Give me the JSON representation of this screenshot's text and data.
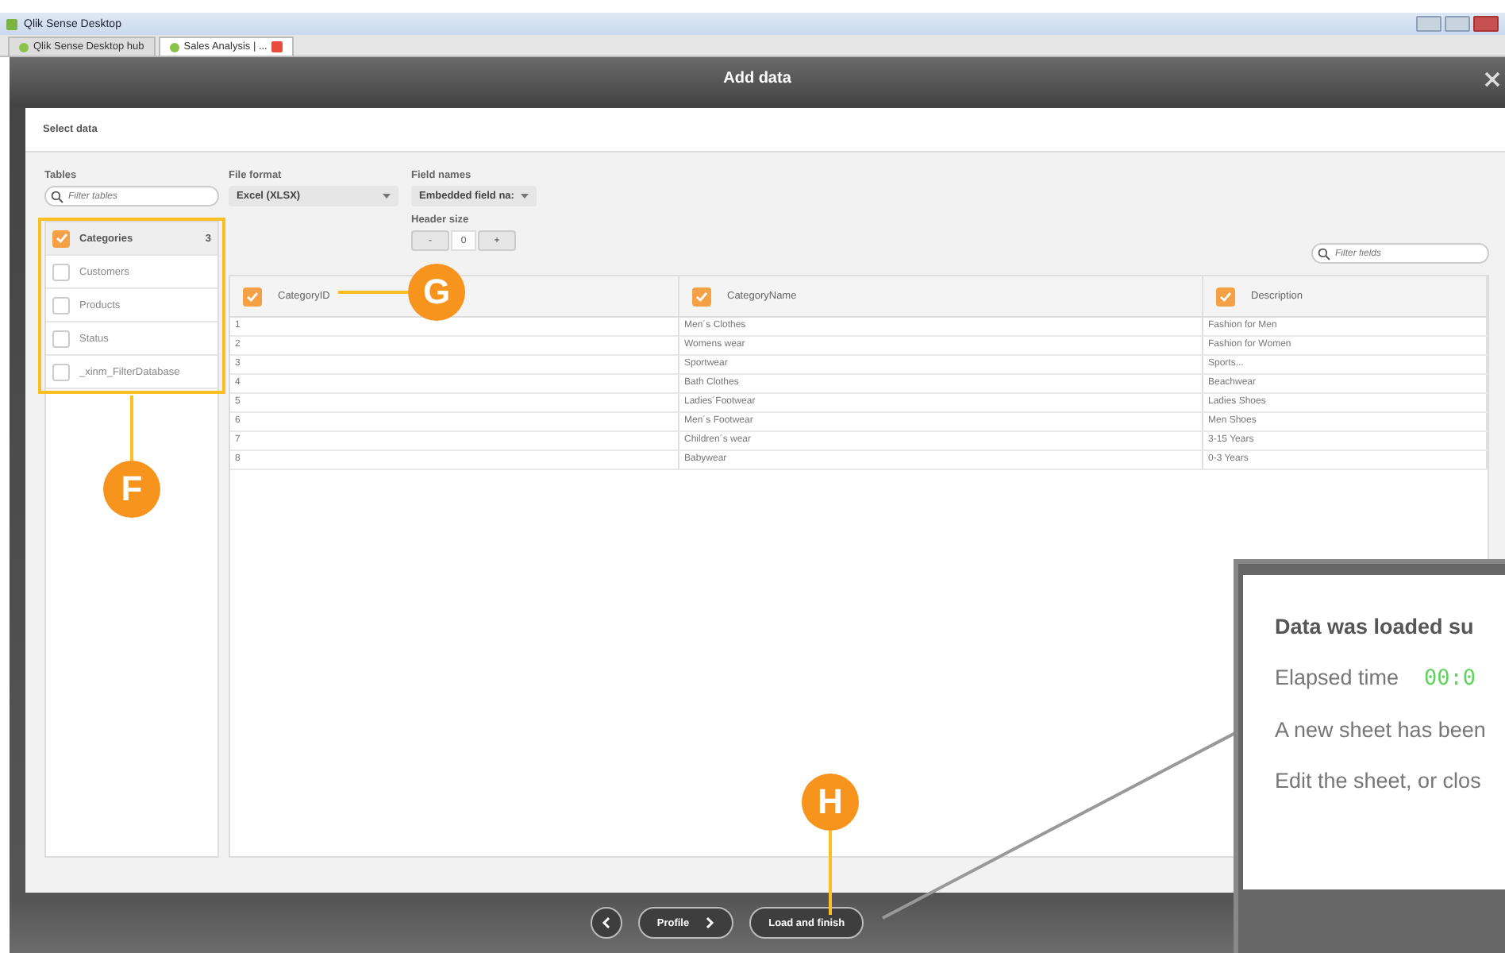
{
  "window": {
    "title": "Qlik Sense Desktop"
  },
  "tabs": [
    {
      "label": "Qlik Sense Desktop hub",
      "selected": false
    },
    {
      "label": "Sales Analysis | ...",
      "selected": true
    }
  ],
  "dialog": {
    "title": "Add data",
    "section": "Select data"
  },
  "tables": {
    "label": "Tables",
    "placeholder": "Filter tables",
    "items": [
      {
        "name": "Categories",
        "checked": true,
        "selected": true,
        "count": "3"
      },
      {
        "name": "Customers",
        "checked": false,
        "selected": false
      },
      {
        "name": "Products",
        "checked": false,
        "selected": false
      },
      {
        "name": "Status",
        "checked": false,
        "selected": false
      },
      {
        "name": "_xinm_FilterDatabase",
        "checked": false,
        "selected": false
      }
    ]
  },
  "file_format": {
    "label": "File format",
    "value": "Excel (XLSX)"
  },
  "field_names": {
    "label": "Field names",
    "value": "Embedded field na:"
  },
  "header_size": {
    "label": "Header size",
    "minus": "-",
    "value": "0",
    "plus": "+"
  },
  "filter_fields": {
    "placeholder": "Filter fields"
  },
  "table": {
    "columns": [
      {
        "name": "CategoryID",
        "checked": true
      },
      {
        "name": "CategoryName",
        "checked": true
      },
      {
        "name": "Description",
        "checked": true
      }
    ],
    "rows": [
      [
        "1",
        "Men´s Clothes",
        "Fashion for Men"
      ],
      [
        "2",
        "Womens wear",
        "Fashion for Women"
      ],
      [
        "3",
        "Sportwear",
        "Sports..."
      ],
      [
        "4",
        "Bath Clothes",
        "Beachwear"
      ],
      [
        "5",
        "Ladies´Footwear",
        "Ladies Shoes"
      ],
      [
        "6",
        "Men´s Footwear",
        "Men Shoes"
      ],
      [
        "7",
        "Children´s wear",
        "3-15 Years"
      ],
      [
        "8",
        "Babywear",
        "0-3 Years"
      ]
    ]
  },
  "footer": {
    "profile": "Profile",
    "load": "Load and finish"
  },
  "callouts": [
    {
      "letter": "F"
    },
    {
      "letter": "G"
    },
    {
      "letter": "H"
    }
  ],
  "popup": {
    "title": "Data was loaded su",
    "elapsed_label": "Elapsed time",
    "elapsed_value": "00:0",
    "message": "A new sheet has been",
    "hint": "Edit the sheet, or clos"
  }
}
